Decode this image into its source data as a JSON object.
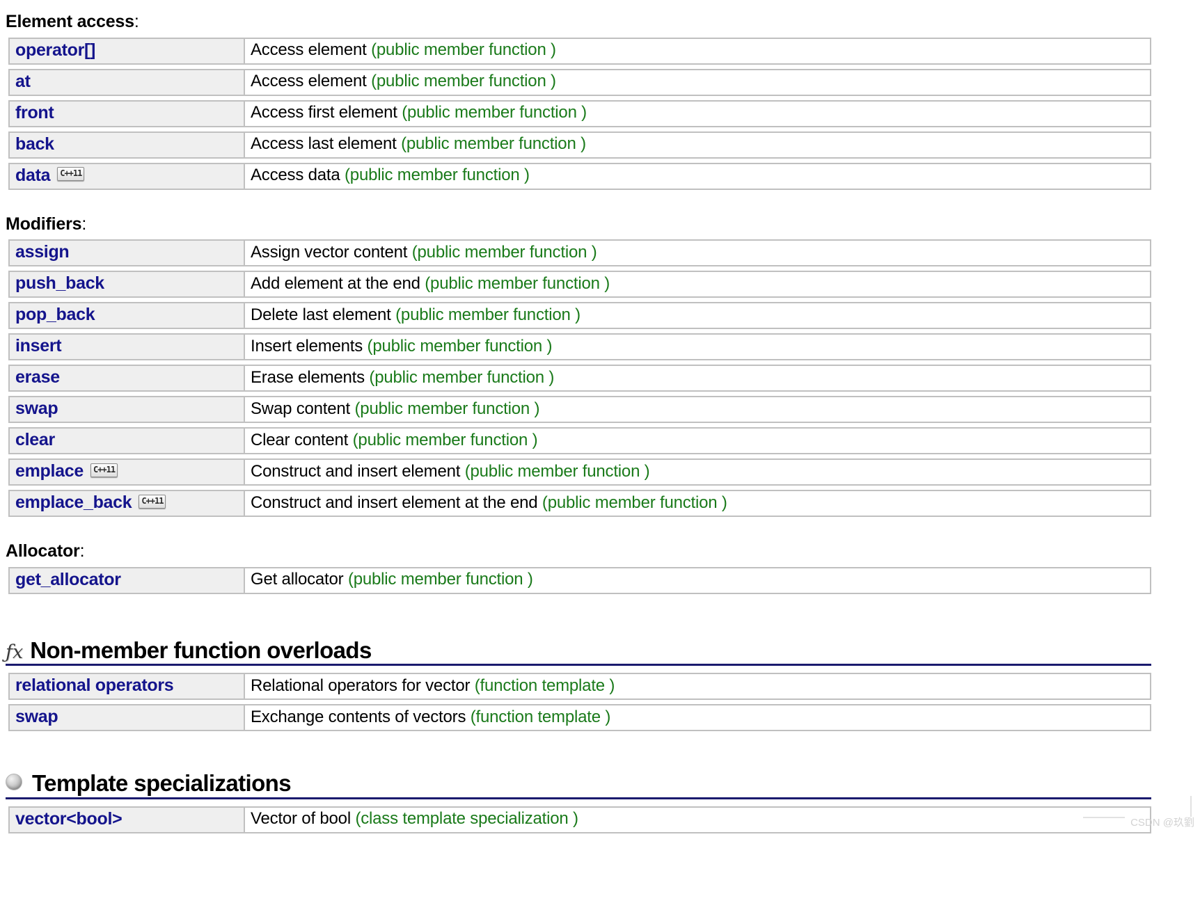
{
  "sections": [
    {
      "id": "element-access",
      "label": "Element access",
      "colon": ":",
      "rows": [
        {
          "name": "operator[]",
          "badge": "",
          "desc": "Access element ",
          "kind": "(public member function )"
        },
        {
          "name": "at",
          "badge": "",
          "desc": "Access element ",
          "kind": "(public member function )"
        },
        {
          "name": "front",
          "badge": "",
          "desc": "Access first element ",
          "kind": "(public member function )"
        },
        {
          "name": "back",
          "badge": "",
          "desc": "Access last element ",
          "kind": "(public member function )"
        },
        {
          "name": "data",
          "badge": "C++11",
          "desc": "Access data ",
          "kind": "(public member function )"
        }
      ]
    },
    {
      "id": "modifiers",
      "label": "Modifiers",
      "colon": ":",
      "rows": [
        {
          "name": "assign",
          "badge": "",
          "desc": "Assign vector content ",
          "kind": "(public member function )"
        },
        {
          "name": "push_back",
          "badge": "",
          "desc": "Add element at the end ",
          "kind": "(public member function )"
        },
        {
          "name": "pop_back",
          "badge": "",
          "desc": "Delete last element ",
          "kind": "(public member function )"
        },
        {
          "name": "insert",
          "badge": "",
          "desc": "Insert elements ",
          "kind": "(public member function )"
        },
        {
          "name": "erase",
          "badge": "",
          "desc": "Erase elements ",
          "kind": "(public member function )"
        },
        {
          "name": "swap",
          "badge": "",
          "desc": "Swap content ",
          "kind": "(public member function )"
        },
        {
          "name": "clear",
          "badge": "",
          "desc": "Clear content ",
          "kind": "(public member function )"
        },
        {
          "name": "emplace",
          "badge": "C++11",
          "desc": "Construct and insert element ",
          "kind": "(public member function )"
        },
        {
          "name": "emplace_back",
          "badge": "C++11",
          "desc": "Construct and insert element at the end ",
          "kind": "(public member function )"
        }
      ]
    },
    {
      "id": "allocator",
      "label": "Allocator",
      "colon": ":",
      "rows": [
        {
          "name": "get_allocator",
          "badge": "",
          "desc": "Get allocator ",
          "kind": "(public member function )"
        }
      ]
    }
  ],
  "headings": [
    {
      "id": "non-member-function-overloads",
      "icon": "fx-icon",
      "icon_glyph": "ƒx",
      "title": "Non-member function overloads",
      "rows": [
        {
          "name": "relational operators",
          "badge": "",
          "desc": "Relational operators for vector ",
          "kind": "(function template )"
        },
        {
          "name": "swap",
          "badge": "",
          "desc": "Exchange contents of vectors ",
          "kind": "(function template )"
        }
      ]
    },
    {
      "id": "template-specializations",
      "icon": "sphere-icon",
      "icon_glyph": "",
      "title": "Template specializations",
      "rows": [
        {
          "name": "vector<bool>",
          "badge": "",
          "desc": "Vector of bool ",
          "kind": "(class template specialization )"
        }
      ]
    }
  ],
  "watermark": {
    "text": "CSDN @玖劉"
  },
  "colors": {
    "link": "#14148c",
    "kind": "#1a7a1a",
    "name_cell_bg": "#efefef",
    "border": "#c0c0c0",
    "heading_rule": "#1a1a6e"
  }
}
